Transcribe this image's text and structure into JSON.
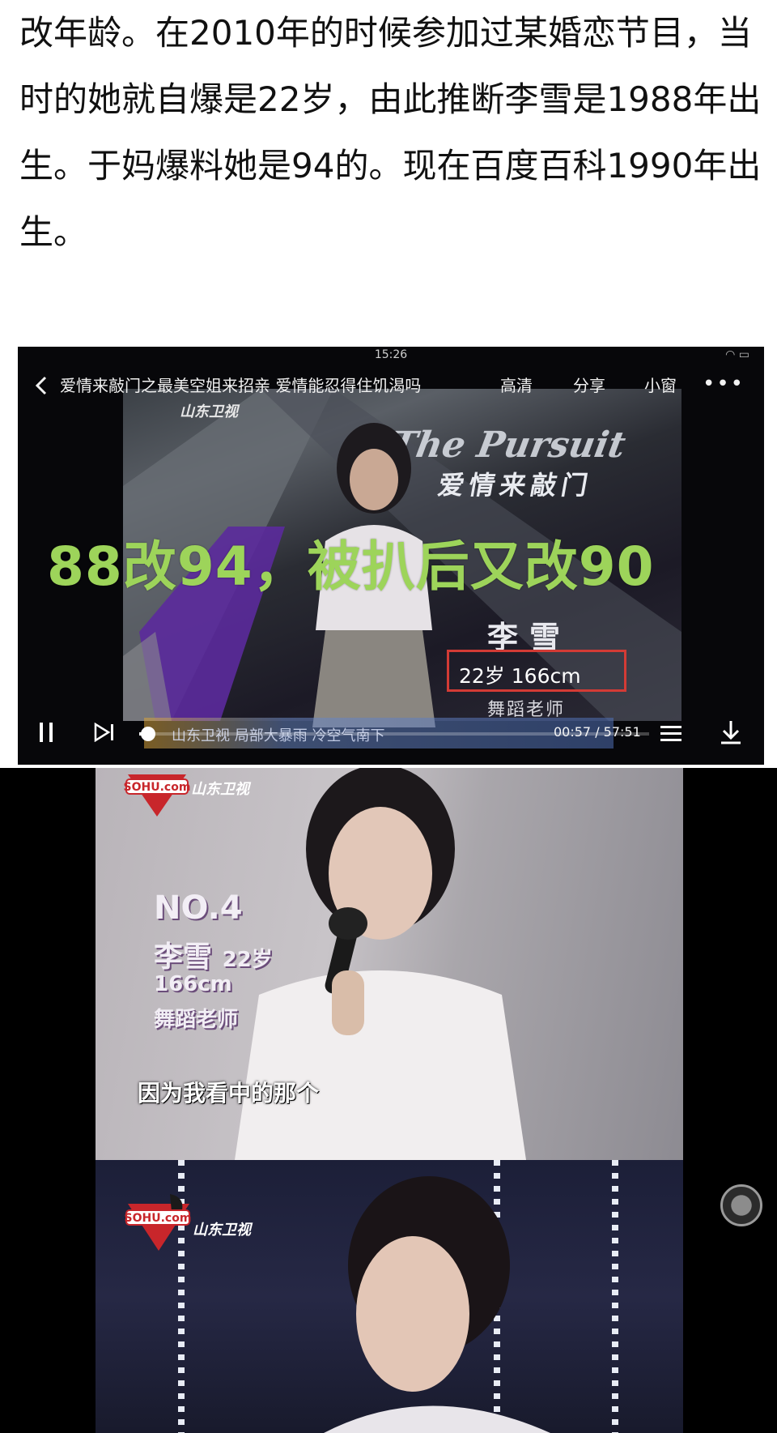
{
  "article": {
    "paragraph": "改年龄。在2010年的时候参加过某婚恋节目，当时的她就自爆是22岁，由此推断李雪是1988年出生。于妈爆料她是94的。现在百度百科1990年出生。"
  },
  "video": {
    "status_time": "15:26",
    "title": "爱情来敲门之最美空姐来招亲 爱情能忍得住饥渴吗",
    "actions": {
      "hd": "高清",
      "share": "分享",
      "mini_window": "小窗"
    },
    "channel_logo": "山东卫视",
    "show_logo_en": "The Pursuit",
    "show_logo_cn": "爱情来敲门",
    "overlay_caption": "88改94，被扒后又改90",
    "name": "李雪",
    "info": "22岁 166cm",
    "job": "舞蹈老师",
    "ticker_text": "山东卫视 局部大暴雨 冷空气南下",
    "time_display": "00:57 / 57:51",
    "progress": 0.017
  },
  "frame2": {
    "logo_text": "SOHU.com",
    "channel": "山东卫视",
    "no": "NO.4",
    "name": "李雪",
    "age": "22岁",
    "height": "166cm",
    "job": "舞蹈老师",
    "subtitle": "因为我看中的那个"
  },
  "frame3": {
    "logo_text": "SOHU.com",
    "channel": "山东卫视"
  },
  "colors": {
    "caption_green": "#9dd45a",
    "highlight_red": "#d33b35"
  }
}
